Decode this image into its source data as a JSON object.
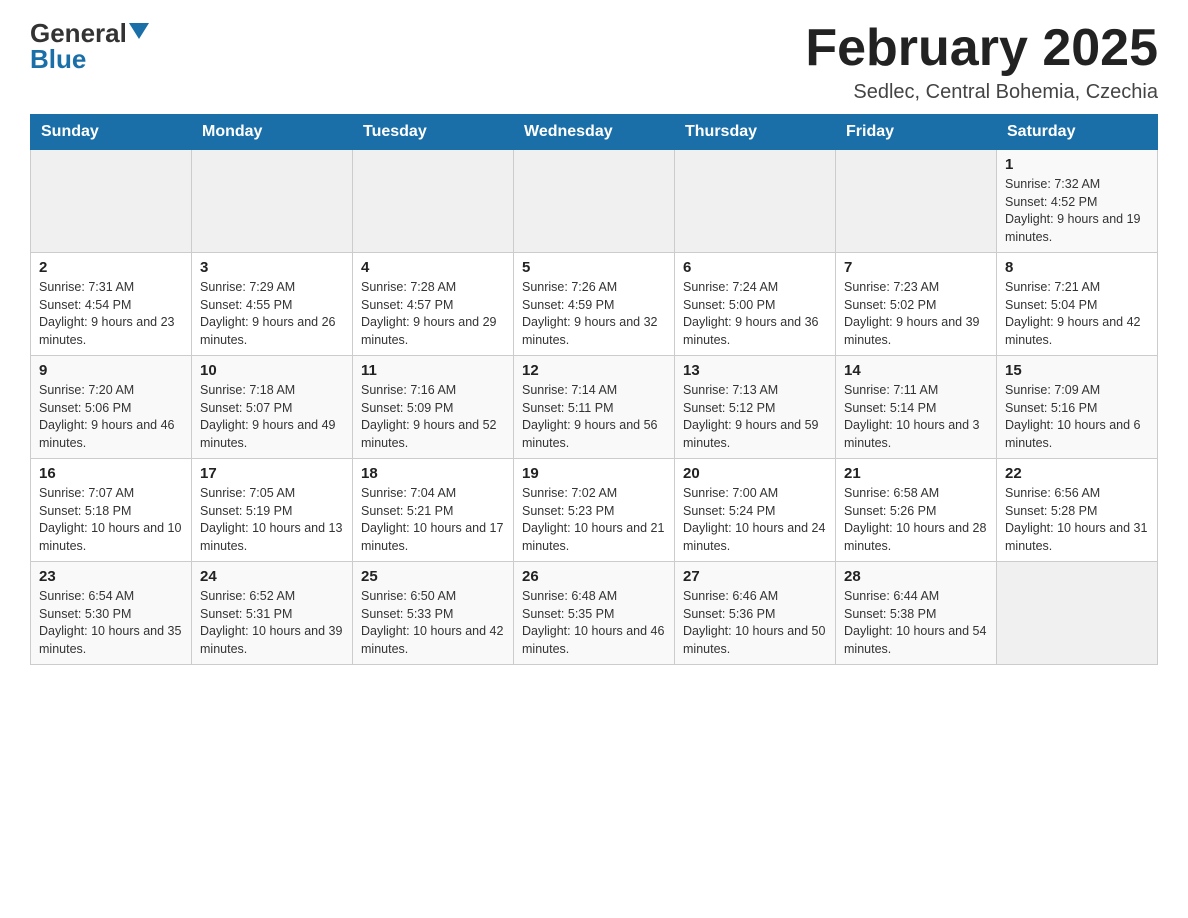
{
  "logo": {
    "general": "General",
    "blue": "Blue"
  },
  "title": {
    "month": "February 2025",
    "location": "Sedlec, Central Bohemia, Czechia"
  },
  "weekdays": [
    "Sunday",
    "Monday",
    "Tuesday",
    "Wednesday",
    "Thursday",
    "Friday",
    "Saturday"
  ],
  "weeks": [
    [
      {
        "day": "",
        "info": ""
      },
      {
        "day": "",
        "info": ""
      },
      {
        "day": "",
        "info": ""
      },
      {
        "day": "",
        "info": ""
      },
      {
        "day": "",
        "info": ""
      },
      {
        "day": "",
        "info": ""
      },
      {
        "day": "1",
        "info": "Sunrise: 7:32 AM\nSunset: 4:52 PM\nDaylight: 9 hours and 19 minutes."
      }
    ],
    [
      {
        "day": "2",
        "info": "Sunrise: 7:31 AM\nSunset: 4:54 PM\nDaylight: 9 hours and 23 minutes."
      },
      {
        "day": "3",
        "info": "Sunrise: 7:29 AM\nSunset: 4:55 PM\nDaylight: 9 hours and 26 minutes."
      },
      {
        "day": "4",
        "info": "Sunrise: 7:28 AM\nSunset: 4:57 PM\nDaylight: 9 hours and 29 minutes."
      },
      {
        "day": "5",
        "info": "Sunrise: 7:26 AM\nSunset: 4:59 PM\nDaylight: 9 hours and 32 minutes."
      },
      {
        "day": "6",
        "info": "Sunrise: 7:24 AM\nSunset: 5:00 PM\nDaylight: 9 hours and 36 minutes."
      },
      {
        "day": "7",
        "info": "Sunrise: 7:23 AM\nSunset: 5:02 PM\nDaylight: 9 hours and 39 minutes."
      },
      {
        "day": "8",
        "info": "Sunrise: 7:21 AM\nSunset: 5:04 PM\nDaylight: 9 hours and 42 minutes."
      }
    ],
    [
      {
        "day": "9",
        "info": "Sunrise: 7:20 AM\nSunset: 5:06 PM\nDaylight: 9 hours and 46 minutes."
      },
      {
        "day": "10",
        "info": "Sunrise: 7:18 AM\nSunset: 5:07 PM\nDaylight: 9 hours and 49 minutes."
      },
      {
        "day": "11",
        "info": "Sunrise: 7:16 AM\nSunset: 5:09 PM\nDaylight: 9 hours and 52 minutes."
      },
      {
        "day": "12",
        "info": "Sunrise: 7:14 AM\nSunset: 5:11 PM\nDaylight: 9 hours and 56 minutes."
      },
      {
        "day": "13",
        "info": "Sunrise: 7:13 AM\nSunset: 5:12 PM\nDaylight: 9 hours and 59 minutes."
      },
      {
        "day": "14",
        "info": "Sunrise: 7:11 AM\nSunset: 5:14 PM\nDaylight: 10 hours and 3 minutes."
      },
      {
        "day": "15",
        "info": "Sunrise: 7:09 AM\nSunset: 5:16 PM\nDaylight: 10 hours and 6 minutes."
      }
    ],
    [
      {
        "day": "16",
        "info": "Sunrise: 7:07 AM\nSunset: 5:18 PM\nDaylight: 10 hours and 10 minutes."
      },
      {
        "day": "17",
        "info": "Sunrise: 7:05 AM\nSunset: 5:19 PM\nDaylight: 10 hours and 13 minutes."
      },
      {
        "day": "18",
        "info": "Sunrise: 7:04 AM\nSunset: 5:21 PM\nDaylight: 10 hours and 17 minutes."
      },
      {
        "day": "19",
        "info": "Sunrise: 7:02 AM\nSunset: 5:23 PM\nDaylight: 10 hours and 21 minutes."
      },
      {
        "day": "20",
        "info": "Sunrise: 7:00 AM\nSunset: 5:24 PM\nDaylight: 10 hours and 24 minutes."
      },
      {
        "day": "21",
        "info": "Sunrise: 6:58 AM\nSunset: 5:26 PM\nDaylight: 10 hours and 28 minutes."
      },
      {
        "day": "22",
        "info": "Sunrise: 6:56 AM\nSunset: 5:28 PM\nDaylight: 10 hours and 31 minutes."
      }
    ],
    [
      {
        "day": "23",
        "info": "Sunrise: 6:54 AM\nSunset: 5:30 PM\nDaylight: 10 hours and 35 minutes."
      },
      {
        "day": "24",
        "info": "Sunrise: 6:52 AM\nSunset: 5:31 PM\nDaylight: 10 hours and 39 minutes."
      },
      {
        "day": "25",
        "info": "Sunrise: 6:50 AM\nSunset: 5:33 PM\nDaylight: 10 hours and 42 minutes."
      },
      {
        "day": "26",
        "info": "Sunrise: 6:48 AM\nSunset: 5:35 PM\nDaylight: 10 hours and 46 minutes."
      },
      {
        "day": "27",
        "info": "Sunrise: 6:46 AM\nSunset: 5:36 PM\nDaylight: 10 hours and 50 minutes."
      },
      {
        "day": "28",
        "info": "Sunrise: 6:44 AM\nSunset: 5:38 PM\nDaylight: 10 hours and 54 minutes."
      },
      {
        "day": "",
        "info": ""
      }
    ]
  ]
}
